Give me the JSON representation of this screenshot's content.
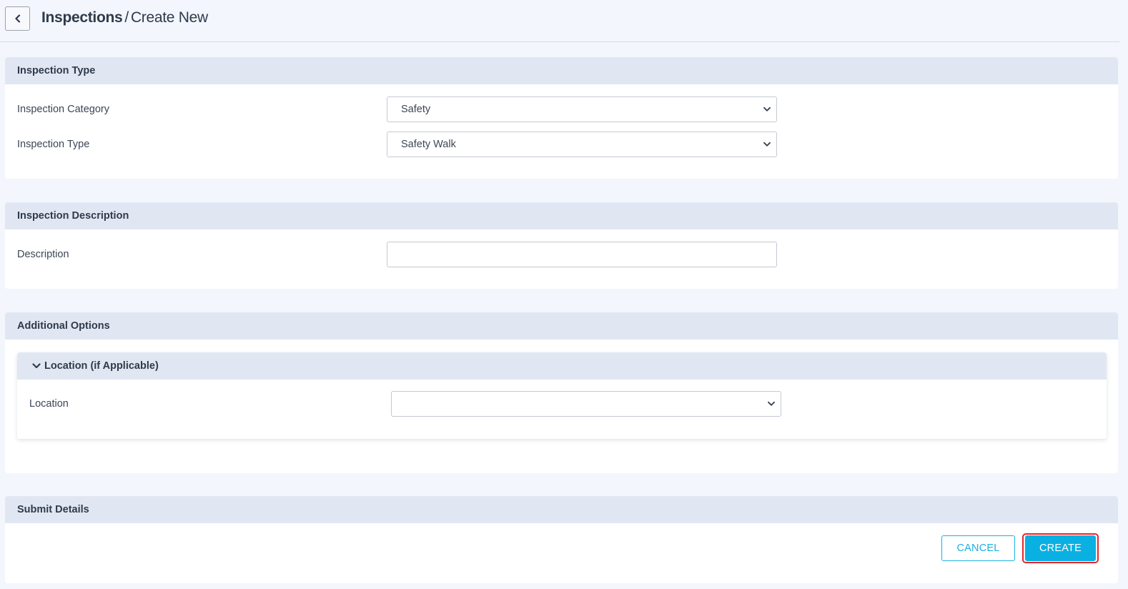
{
  "breadcrumb": {
    "root": "Inspections",
    "separator": "/",
    "current": "Create New"
  },
  "icons": {
    "back": "chevron-left-icon",
    "dropdown": "chevron-down-icon",
    "collapse": "chevron-down-icon"
  },
  "sections": {
    "type": {
      "title": "Inspection Type",
      "category_label": "Inspection Category",
      "category_value": "Safety",
      "type_label": "Inspection Type",
      "type_value": "Safety Walk"
    },
    "description": {
      "title": "Inspection Description",
      "label": "Description",
      "value": ""
    },
    "additional": {
      "title": "Additional Options",
      "location_group": {
        "title": "Location (if Applicable)",
        "label": "Location",
        "value": ""
      }
    },
    "submit": {
      "title": "Submit Details",
      "cancel_label": "CANCEL",
      "create_label": "CREATE"
    }
  },
  "colors": {
    "accent": "#0bb0e2",
    "highlight": "#e5252a",
    "panel_header": "#e1e7f2",
    "background": "#f3f6fc"
  }
}
